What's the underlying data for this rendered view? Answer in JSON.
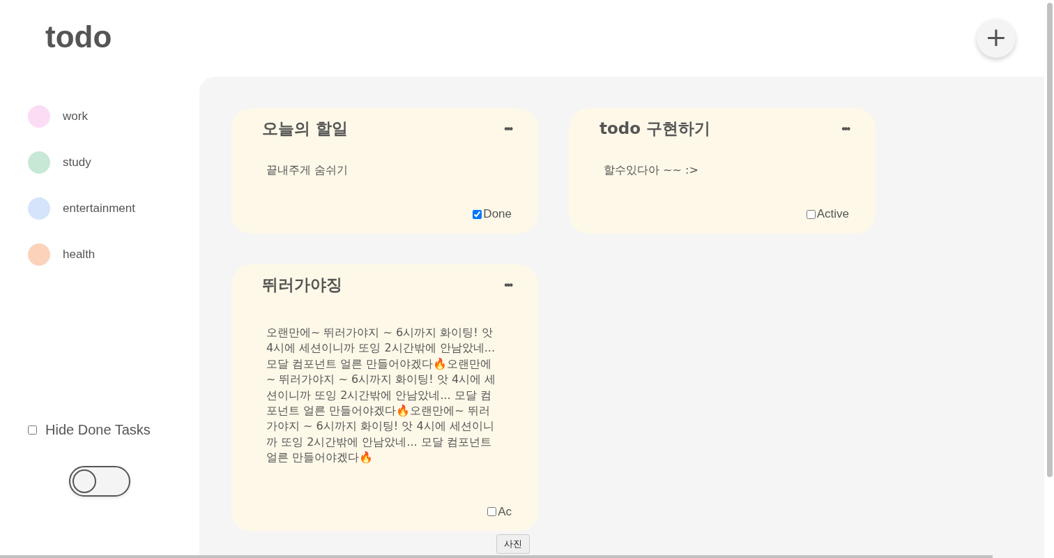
{
  "header": {
    "title": "todo",
    "add_button": "+"
  },
  "categories": [
    {
      "label": "work",
      "color": "#fbdcf5"
    },
    {
      "label": "study",
      "color": "#c8e8d6"
    },
    {
      "label": "entertainment",
      "color": "#d6e4fb"
    },
    {
      "label": "health",
      "color": "#fbd3bb"
    }
  ],
  "hide_done": {
    "label": "Hide Done Tasks",
    "checked": false
  },
  "theme_toggle": {
    "on": false
  },
  "cards": [
    {
      "title": "오늘의 할일",
      "menu": "•••",
      "body": "끝내주게 숨쉬기",
      "status": "Done",
      "checked": true
    },
    {
      "title": "todo 구현하기",
      "menu": "•••",
      "body": "할수있다아 ~~ :>",
      "status": "Active",
      "checked": false
    },
    {
      "title": "뛰러가야징",
      "menu": "•••",
      "body": "오랜만에~ 뛰러가야지 ~ 6시까지 화이팅! 앗 4시에 세션이니까 또잉 2시간밖에 안남았네... 모달 컴포넌트 얼른 만들어야겠다🔥오랜만에~ 뛰러가야지 ~ 6시까지 화이팅! 앗 4시에 세션이니까 또잉 2시간밖에 안남았네... 모달 컴포넌트 얼른 만들어야겠다🔥오랜만에~ 뛰러가야지 ~ 6시까지 화이팅! 앗 4시에 세션이니까 또잉 2시간밖에 안남았네... 모달 컴포넌트 얼른 만들어야겠다🔥",
      "status": "Ac",
      "checked": false
    }
  ],
  "tooltip": {
    "text": "사진"
  }
}
